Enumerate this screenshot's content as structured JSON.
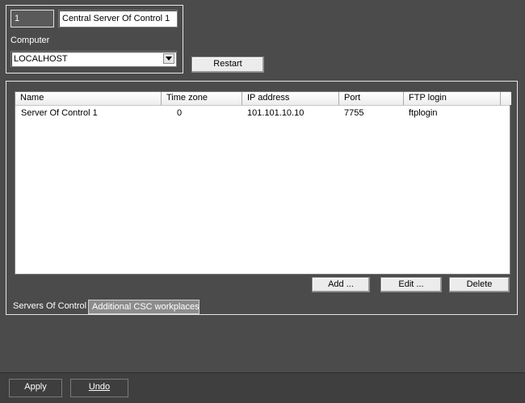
{
  "header": {
    "id_value": "1",
    "name_value": "Central Server Of Control 1",
    "computer_label": "Computer",
    "computer_selected": "LOCALHOST",
    "restart_label": "Restart"
  },
  "servers_table": {
    "columns": [
      "Name",
      "Time zone",
      "IP address",
      "Port",
      "FTP login"
    ],
    "rows": [
      {
        "name": "Server Of Control 1",
        "time_zone": "0",
        "ip": "101.101.10.10",
        "port": "7755",
        "ftp_login": "ftplogin"
      }
    ]
  },
  "table_actions": {
    "add_label": "Add ...",
    "edit_label": "Edit ...",
    "delete_label": "Delete"
  },
  "tabs": [
    {
      "label": "Servers Of Control",
      "active": true
    },
    {
      "label": "Additional CSC workplaces",
      "active": false
    }
  ],
  "footer": {
    "apply_label": "Apply",
    "undo_label": "Undo"
  }
}
